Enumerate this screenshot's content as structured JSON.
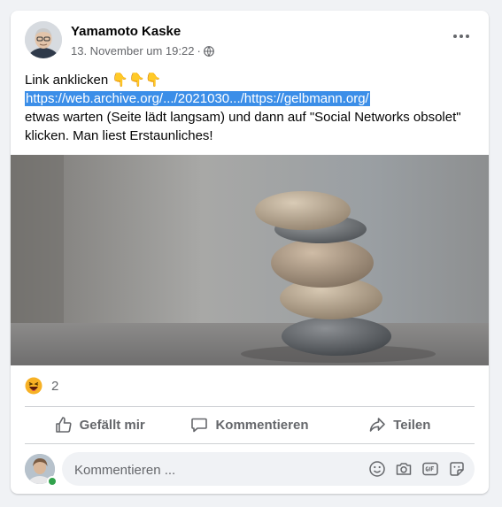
{
  "post": {
    "author": "Yamamoto Kaske",
    "timestamp": "13. November um 19:22",
    "separator": "·",
    "audience_icon": "globe-icon",
    "more_icon": "more-horizontal-icon",
    "text_line1": "Link anklicken 👇👇👇",
    "link": "https://web.archive.org/.../2021030.../https://gelbmann.org/",
    "text_line3": "etwas warten (Seite lädt langsam) und dann auf \"Social Networks obsolet\" klicken. Man liest Erstaunliches!",
    "photo": "stacked-pebbles-photo"
  },
  "reactions": {
    "icon": "haha-reaction-icon",
    "count": "2"
  },
  "actions": {
    "like": "Gefällt mir",
    "comment": "Kommentieren",
    "share": "Teilen"
  },
  "comment_box": {
    "placeholder": "Kommentieren ...",
    "icons": [
      "emoji-icon",
      "camera-icon",
      "gif-icon",
      "sticker-icon"
    ]
  },
  "colors": {
    "link_highlight": "#3b8ee8",
    "secondary_text": "#65676b",
    "online": "#31a24c"
  }
}
